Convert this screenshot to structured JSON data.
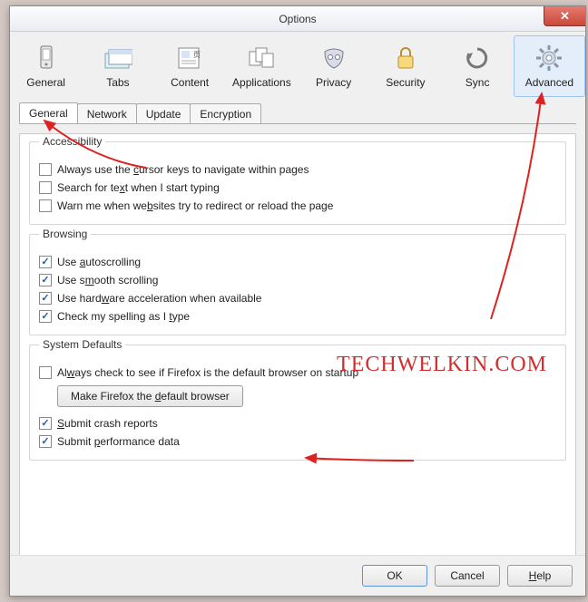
{
  "window": {
    "title": "Options"
  },
  "toolbar": {
    "items": [
      {
        "label": "General",
        "icon": "phone"
      },
      {
        "label": "Tabs",
        "icon": "tabs"
      },
      {
        "label": "Content",
        "icon": "content"
      },
      {
        "label": "Applications",
        "icon": "apps"
      },
      {
        "label": "Privacy",
        "icon": "mask"
      },
      {
        "label": "Security",
        "icon": "lock"
      },
      {
        "label": "Sync",
        "icon": "sync"
      },
      {
        "label": "Advanced",
        "icon": "gear",
        "active": true
      }
    ]
  },
  "tabs": [
    {
      "label": "General",
      "active": true
    },
    {
      "label": "Network"
    },
    {
      "label": "Update"
    },
    {
      "label": "Encryption"
    }
  ],
  "groups": {
    "accessibility": {
      "legend": "Accessibility",
      "items": [
        {
          "checked": false,
          "pre": "Always use the ",
          "accel": "c",
          "post": "ursor keys to navigate within pages"
        },
        {
          "checked": false,
          "pre": "Search for te",
          "accel": "x",
          "post": "t when I start typing"
        },
        {
          "checked": false,
          "pre": "Warn me when we",
          "accel": "b",
          "post": "sites try to redirect or reload the page"
        }
      ]
    },
    "browsing": {
      "legend": "Browsing",
      "items": [
        {
          "checked": true,
          "pre": "Use ",
          "accel": "a",
          "post": "utoscrolling"
        },
        {
          "checked": true,
          "pre": "Use s",
          "accel": "m",
          "post": "ooth scrolling"
        },
        {
          "checked": true,
          "pre": "Use hard",
          "accel": "w",
          "post": "are acceleration when available"
        },
        {
          "checked": true,
          "pre": "Check my spelling as I ",
          "accel": "t",
          "post": "ype"
        }
      ]
    },
    "system": {
      "legend": "System Defaults",
      "check_default": {
        "checked": false,
        "pre": "Al",
        "accel": "w",
        "post": "ays check to see if Firefox is the default browser on startup"
      },
      "button": {
        "pre": "Make Firefox the ",
        "accel": "d",
        "post": "efault browser"
      },
      "crash": {
        "checked": true,
        "pre": "",
        "accel": "S",
        "post": "ubmit crash reports"
      },
      "perf": {
        "checked": true,
        "pre": "Submit ",
        "accel": "p",
        "post": "erformance data"
      }
    }
  },
  "footer": {
    "ok": "OK",
    "cancel": "Cancel",
    "help_pre": "",
    "help_accel": "H",
    "help_post": "elp"
  },
  "watermark": "TECHWELKIN.COM"
}
